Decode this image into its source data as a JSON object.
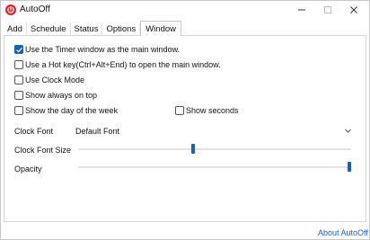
{
  "window": {
    "title": "AutoOff",
    "accent_color": "#1a5fb4",
    "icon_color": "#d4272f"
  },
  "tabs": [
    {
      "label": "Add",
      "active": false
    },
    {
      "label": "Schedule",
      "active": false
    },
    {
      "label": "Status",
      "active": false
    },
    {
      "label": "Options",
      "active": false
    },
    {
      "label": "Window",
      "active": true
    }
  ],
  "window_tab": {
    "checkboxes": [
      {
        "label": "Use the Timer window as the main window.",
        "checked": true
      },
      {
        "label": "Use a Hot key(Ctrl+Alt+End) to open the main window.",
        "checked": false
      },
      {
        "label": "Use Clock Mode",
        "checked": false
      },
      {
        "label": "Show always on top",
        "checked": false
      },
      {
        "label": "Show the day of the week",
        "checked": false
      },
      {
        "label": "Show seconds",
        "checked": false
      }
    ],
    "clock_font": {
      "label": "Clock Font",
      "value": "Default Font"
    },
    "clock_font_size": {
      "label": "Clock Font Size",
      "level": 0.42
    },
    "opacity": {
      "label": "Opacity",
      "level": 1.0
    }
  },
  "footer": {
    "about_link": "About AutoOff"
  }
}
